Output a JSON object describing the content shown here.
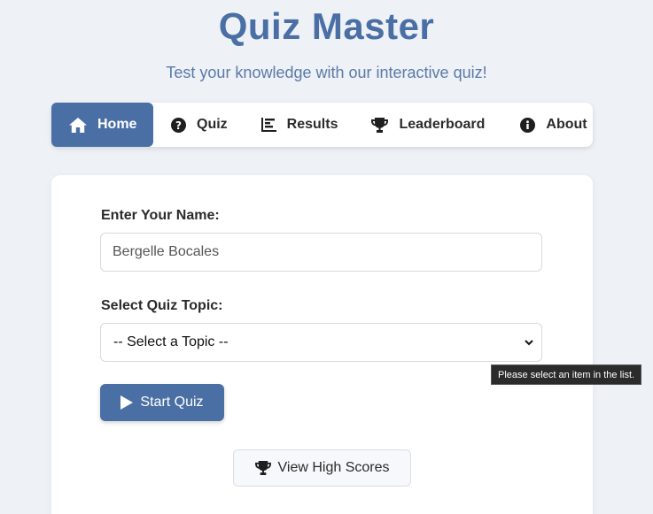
{
  "header": {
    "title": "Quiz Master",
    "subtitle": "Test your knowledge with our interactive quiz!"
  },
  "nav": {
    "items": [
      {
        "label": "Home",
        "icon": "home-icon",
        "active": true
      },
      {
        "label": "Quiz",
        "icon": "question-circle-icon",
        "active": false
      },
      {
        "label": "Results",
        "icon": "bar-chart-icon",
        "active": false
      },
      {
        "label": "Leaderboard",
        "icon": "trophy-icon",
        "active": false
      },
      {
        "label": "About",
        "icon": "info-circle-icon",
        "active": false
      }
    ]
  },
  "form": {
    "name_label": "Enter Your Name:",
    "name_value": "Bergelle Bocales",
    "topic_label": "Select Quiz Topic:",
    "topic_selected": "-- Select a Topic --",
    "start_button": "Start Quiz",
    "high_scores_button": "View High Scores"
  },
  "tooltip": {
    "text": "Please select an item in the list."
  },
  "colors": {
    "accent": "#4a6fa5",
    "background": "#eef1f6",
    "card": "#ffffff"
  }
}
